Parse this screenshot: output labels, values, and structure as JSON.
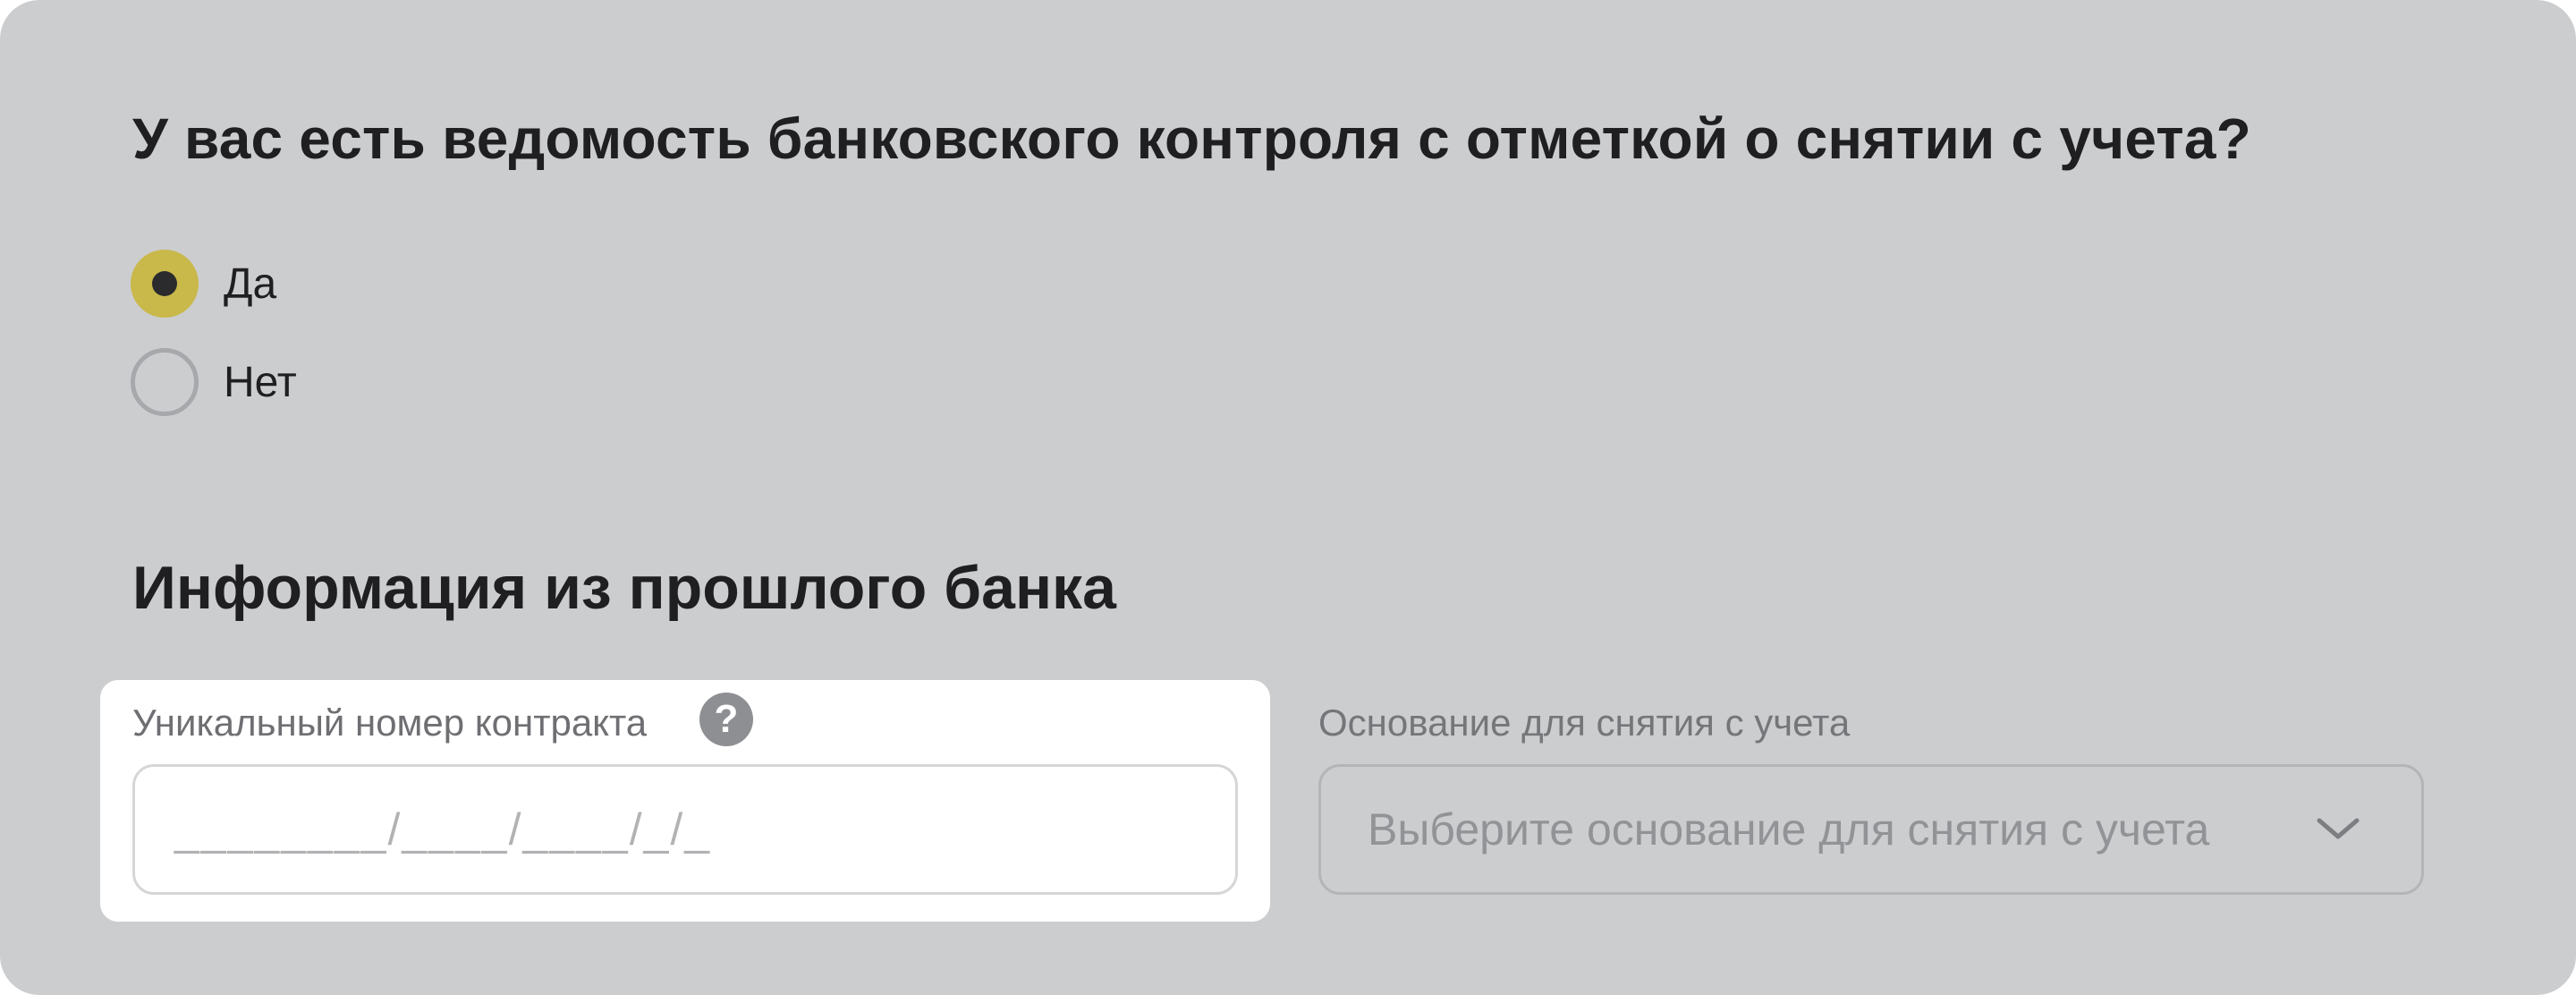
{
  "form": {
    "question": "У вас есть ведомость банковского контроля с отметкой о снятии с учета?",
    "options": [
      {
        "label": "Да",
        "selected": true
      },
      {
        "label": "Нет",
        "selected": false
      }
    ],
    "section_title": "Информация из прошлого банка",
    "contract_field": {
      "label": "Уникальный номер контракта",
      "help_icon": "help-question-icon",
      "placeholder": "________/____/____/_/_",
      "value": ""
    },
    "reason_field": {
      "label": "Основание для снятия с учета",
      "placeholder": "Выберите основание для снятия с учета",
      "icon": "chevron-down-icon"
    }
  },
  "colors": {
    "panel_bg": "#cccdcf",
    "accent": "#c9b84a",
    "text": "#1f1f22",
    "muted": "#6f6f73"
  }
}
